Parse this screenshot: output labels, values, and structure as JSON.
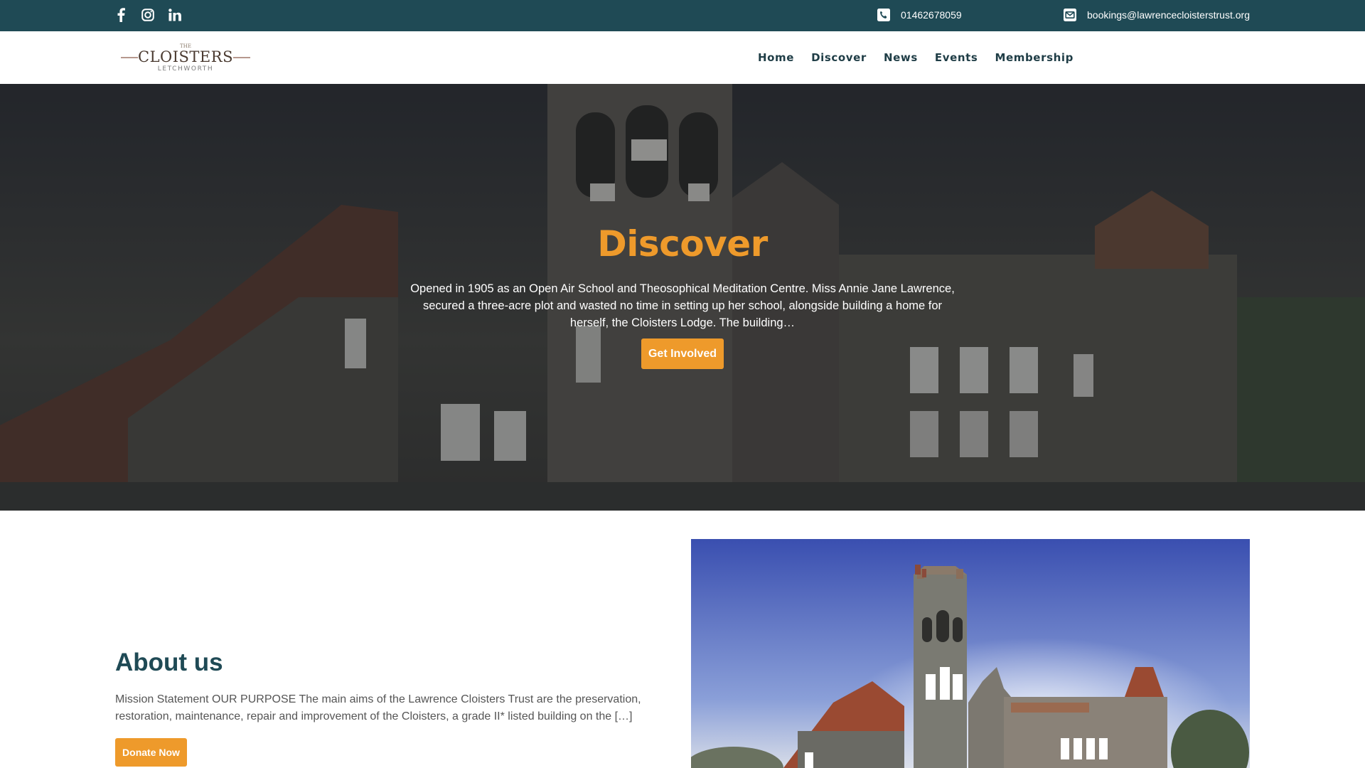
{
  "topbar": {
    "social": [
      {
        "icon": "facebook-icon"
      },
      {
        "icon": "instagram-icon"
      },
      {
        "icon": "linkedin-icon"
      }
    ],
    "phone": {
      "icon": "phone-icon",
      "text": "01462678059"
    },
    "email": {
      "icon": "envelope-icon",
      "text": "bookings@lawrencecloisterstrust.org"
    }
  },
  "header": {
    "logo": {
      "top": "THE",
      "main": "CLOISTERS",
      "sub": "LETCHWORTH"
    },
    "nav": [
      "Home",
      "Discover",
      "News",
      "Events",
      "Membership"
    ]
  },
  "hero": {
    "title": "Discover",
    "text": "Opened in 1905 as an Open Air School and Theosophical Meditation Centre. Miss Annie Jane Lawrence, secured a three-acre plot and wasted no time in setting up her school, alongside building a home for herself, the Cloisters Lodge. The building…",
    "button": "Get Involved"
  },
  "about": {
    "title": "About us",
    "text": "Mission Statement OUR PURPOSE The main aims of the Lawrence Cloisters Trust are the preservation, restoration, maintenance, repair and improvement of the Cloisters, a grade II* listed building on the […]",
    "button": "Donate Now"
  },
  "colors": {
    "topbar": "#1f4a55",
    "accent": "#ee9a2b",
    "heading": "#1f4a55",
    "nav": "#1f3d46",
    "body_text": "#555555"
  }
}
